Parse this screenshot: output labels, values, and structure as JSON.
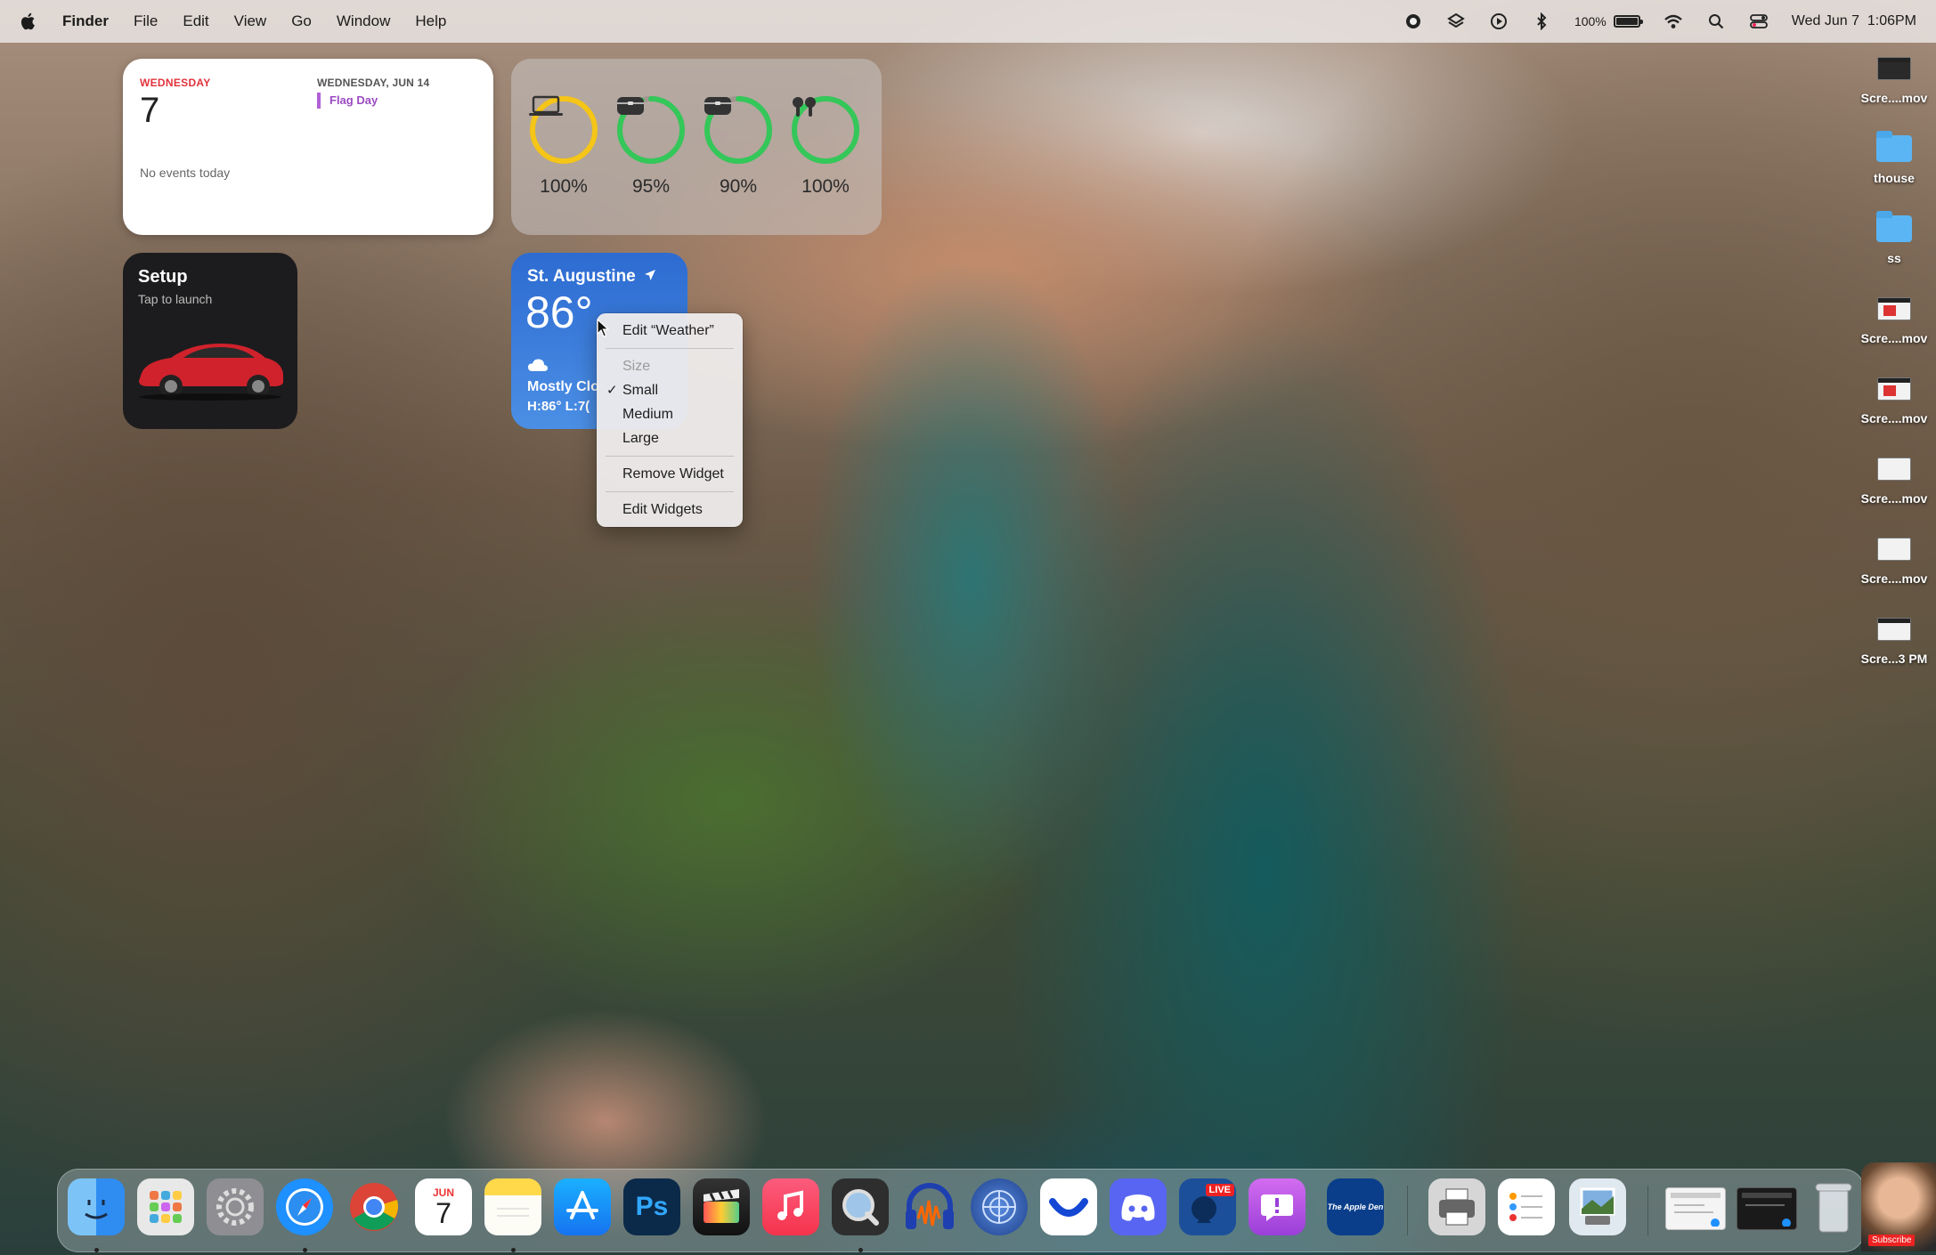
{
  "menubar": {
    "app_name": "Finder",
    "items": [
      "File",
      "Edit",
      "View",
      "Go",
      "Window",
      "Help"
    ],
    "battery_pct": "100%",
    "datetime": "Wed Jun 7  1:06PM"
  },
  "calendar_widget": {
    "weekday": "WEDNESDAY",
    "date": "7",
    "no_events": "No events today",
    "next_header": "WEDNESDAY, JUN 14",
    "next_event": "Flag Day",
    "event_color": "#b05fd6"
  },
  "battery_widget": {
    "devices": [
      {
        "icon": "laptop-icon",
        "pct": "100%",
        "ring_color": "#f5c518",
        "level": 1.0
      },
      {
        "icon": "airpods-case-icon",
        "pct": "95%",
        "ring_color": "#34c759",
        "level": 0.95
      },
      {
        "icon": "airpods-case-icon",
        "pct": "90%",
        "ring_color": "#34c759",
        "level": 0.9
      },
      {
        "icon": "airpods-icon",
        "pct": "100%",
        "ring_color": "#34c759",
        "level": 1.0
      }
    ]
  },
  "tesla_widget": {
    "title": "Setup",
    "subtitle": "Tap to launch"
  },
  "weather_widget": {
    "city": "St. Augustine",
    "temp": "86°",
    "condition": "Mostly Clo",
    "high_low": "H:86° L:7("
  },
  "context_menu": {
    "edit_label": "Edit “Weather”",
    "size_header": "Size",
    "sizes": [
      {
        "label": "Small",
        "checked": true
      },
      {
        "label": "Medium",
        "checked": false
      },
      {
        "label": "Large",
        "checked": false
      }
    ],
    "check_mark": "✓",
    "remove_label": "Remove Widget",
    "edit_widgets_label": "Edit Widgets"
  },
  "desktop_icons": [
    {
      "label": "Scre....mov",
      "kind": "video-dark"
    },
    {
      "label": "thouse",
      "kind": "folder"
    },
    {
      "label": "ss",
      "kind": "folder"
    },
    {
      "label": "Scre....mov",
      "kind": "video-red"
    },
    {
      "label": "Scre....mov",
      "kind": "video-red"
    },
    {
      "label": "Scre....mov",
      "kind": "video-light"
    },
    {
      "label": "Scre....mov",
      "kind": "video-light"
    },
    {
      "label": "Scre...3 PM",
      "kind": "screenshot"
    }
  ],
  "dock": {
    "apps": [
      {
        "name": "Finder",
        "icon": "finder-icon",
        "color": "#2f8cf0",
        "running": true
      },
      {
        "name": "Launchpad",
        "icon": "launchpad-icon",
        "color": "#e8e8e8",
        "running": false
      },
      {
        "name": "System Settings",
        "icon": "gear-icon",
        "color": "#8e8e93",
        "running": false
      },
      {
        "name": "Safari",
        "icon": "safari-icon",
        "color": "#1e90ff",
        "running": true
      },
      {
        "name": "Chrome",
        "icon": "chrome-icon",
        "color": "#ffffff",
        "running": false
      },
      {
        "name": "Calendar",
        "icon": "calendar-icon",
        "color": "#ffffff",
        "running": false
      },
      {
        "name": "Notes",
        "icon": "notes-icon",
        "color": "#ffe066",
        "running": true
      },
      {
        "name": "App Store",
        "icon": "appstore-icon",
        "color": "#1a8cff",
        "running": false
      },
      {
        "name": "Photoshop",
        "icon": "photoshop-icon",
        "color": "#0b2a4a",
        "running": false
      },
      {
        "name": "Final Cut Pro",
        "icon": "clapper-icon",
        "color": "#2c2c2c",
        "running": false
      },
      {
        "name": "Music",
        "icon": "music-icon",
        "color": "#fa3c52",
        "running": false
      },
      {
        "name": "QuickTime",
        "icon": "quicktime-icon",
        "color": "#3a3a3a",
        "running": true
      },
      {
        "name": "Audacity",
        "icon": "headphones-icon",
        "color": "#1e3fb0",
        "running": false
      },
      {
        "name": "Network Radar",
        "icon": "radar-icon",
        "color": "#2a5db0",
        "running": false
      },
      {
        "name": "Smile",
        "icon": "smile-icon",
        "color": "#ffffff",
        "running": false
      },
      {
        "name": "Discord",
        "icon": "discord-icon",
        "color": "#5865f2",
        "running": false
      },
      {
        "name": "Live App",
        "icon": "live-icon",
        "color": "#1c4f9a",
        "running": false
      },
      {
        "name": "Feedback",
        "icon": "feedback-icon",
        "color": "#b84ae6",
        "running": false
      },
      {
        "name": "The Apple Den",
        "icon": "appleden-icon",
        "color": "#0a3e8a",
        "running": false
      },
      {
        "name": "Printer",
        "icon": "printer-icon",
        "color": "#cfcfcf",
        "running": false
      },
      {
        "name": "Reminders",
        "icon": "reminders-icon",
        "color": "#ffffff",
        "running": false
      },
      {
        "name": "Preview",
        "icon": "preview-icon",
        "color": "#a8c8e8",
        "running": false
      }
    ],
    "live_badge": "LIVE",
    "calendar_month": "JUN",
    "calendar_day": "7",
    "ps_label": "Ps",
    "appleden_label": "The Apple Den",
    "subscribe_label": "Subscribe"
  }
}
